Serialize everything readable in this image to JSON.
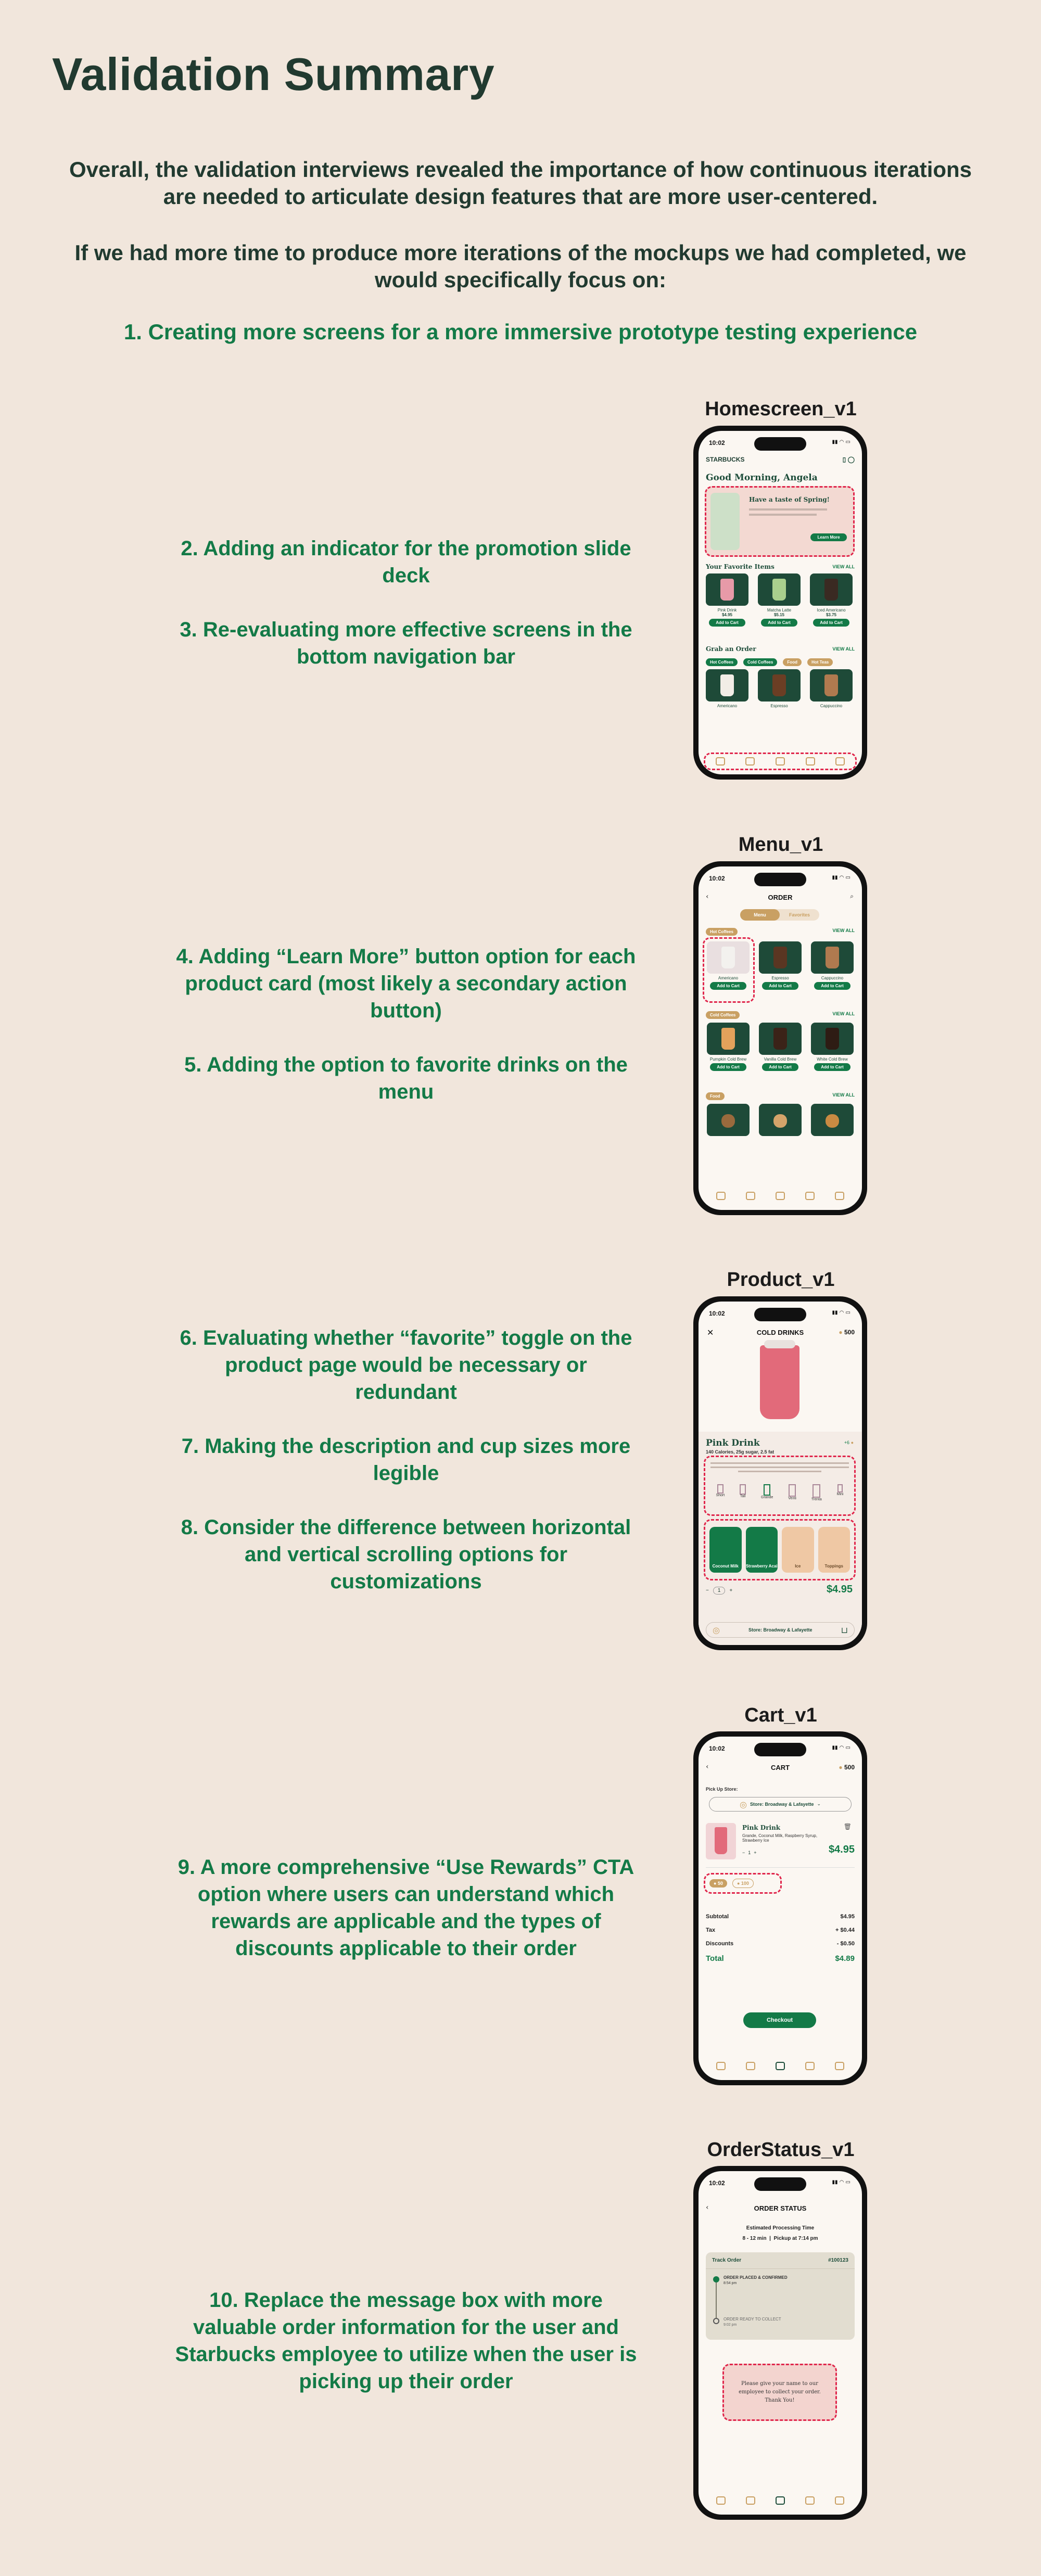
{
  "title": "Validation Summary",
  "intro_1": "Overall, the validation interviews revealed the importance of how continuous iterations are needed to articulate design features that are more user-centered.",
  "intro_2": "If we had more time to produce more iterations of the mockups we had completed, we would specifically focus on:",
  "item_1": "1.  Creating more screens for a more immersive prototype testing experience",
  "sections": [
    {
      "label": "Homescreen_v1",
      "notes": [
        "2. Adding an indicator for the promotion slide deck",
        "3. Re-evaluating more effective screens in the bottom navigation bar"
      ]
    },
    {
      "label": "Menu_v1",
      "notes": [
        "4. Adding “Learn More” button option for each product card (most likely a secondary action button)",
        "5. Adding the option to favorite drinks on the menu"
      ]
    },
    {
      "label": "Product_v1",
      "notes": [
        "6. Evaluating whether “favorite” toggle on the product page would be necessary or redundant",
        "7. Making the description and cup sizes more legible",
        "8. Consider the difference between horizontal and vertical scrolling options for customizations"
      ]
    },
    {
      "label": "Cart_v1",
      "notes": [
        "9. A more comprehensive “Use Rewards” CTA option where users can understand which rewards are applicable and the types of discounts applicable to their order"
      ]
    },
    {
      "label": "OrderStatus_v1",
      "notes": [
        "10. Replace the message box with more valuable order information for the user and Starbucks employee to utilize when the user is picking up their order"
      ]
    }
  ],
  "phone": {
    "time": "10:02",
    "home": {
      "brand": "STARBUCKS",
      "greeting": "Good Morning, Angela",
      "promo_title": "Have a taste of Spring!",
      "promo_btn": "Learn More",
      "favorites": "Your Favorite Items",
      "view_all": "VIEW ALL",
      "fav_items": [
        {
          "name": "Pink Drink",
          "price": "$4.95"
        },
        {
          "name": "Matcha Latte",
          "price": "$5.15"
        },
        {
          "name": "Iced Americano",
          "price": "$3.75"
        }
      ],
      "add_to_cart": "Add to Cart",
      "grab": "Grab an Order",
      "grab_chips": [
        "Hot Coffees",
        "Cold Coffees",
        "Food",
        "Hot Teas"
      ],
      "grab_items": [
        "Americano",
        "Espresso",
        "Cappuccino"
      ]
    },
    "menu": {
      "title": "ORDER",
      "tab_menu": "Menu",
      "tab_fav": "Favorites",
      "view_all": "VIEW ALL",
      "cat_1": "Hot Coffees",
      "items_1": [
        "Americano",
        "Espresso",
        "Cappuccino"
      ],
      "cat_2": "Cold Coffees",
      "items_2": [
        "Pumpkin Cold Brew",
        "Vanilla Cold Brew",
        "White Cold Brew"
      ],
      "cat_3": "Food",
      "add_to_cart": "Add to Cart"
    },
    "product": {
      "header": "COLD DRINKS",
      "points": "500",
      "name": "Pink Drink",
      "meta": "140 Calories, 25g sugar, 2.5 fat",
      "sizes": [
        "Short",
        "Tall",
        "Grande",
        "Venti",
        "Trenta",
        "Mini"
      ],
      "custom": [
        "Coconut Milk",
        "Strawberry Acai",
        "Ice",
        "Toppings"
      ],
      "qty": "1",
      "price": "$4.95",
      "store": "Store: Broadway & Lafayette"
    },
    "cart": {
      "title": "CART",
      "points": "500",
      "pickup": "Pick Up Store:",
      "store": "Store: Broadway & Lafayette",
      "item_name": "Pink Drink",
      "item_detail": "Grande, Coconut Milk, Raspberry Syrup, Strawberry Ice",
      "qty": "1",
      "item_price": "$4.95",
      "reward_1": "50",
      "reward_2": "100",
      "subtotal_label": "Subtotal",
      "subtotal": "$4.95",
      "tax_label": "Tax",
      "tax": "+ $0.44",
      "discounts_label": "Discounts",
      "discounts": "- $0.50",
      "total_label": "Total",
      "total": "$4.89",
      "checkout": "Checkout"
    },
    "status": {
      "title": "ORDER STATUS",
      "est": "Estimated Processing Time",
      "est_val": "8 - 12 min",
      "pickup": "Pickup at 7:14 pm",
      "track": "Track Order",
      "order_no": "#100123",
      "step_1": "ORDER PLACED & CONFIRMED",
      "step_1_time": "8:54 pm",
      "step_2": "ORDER READY TO COLLECT",
      "step_2_time": "9:02 pm",
      "message": "Please give your name to our employee to collect your order. Thank You!"
    }
  }
}
